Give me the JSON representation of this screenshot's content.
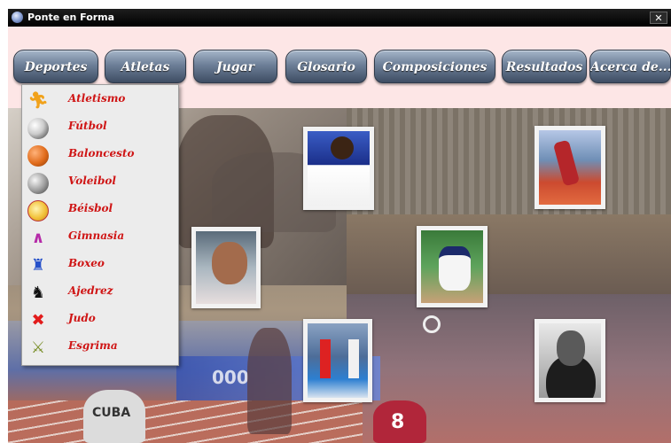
{
  "window": {
    "title": "Ponte en Forma",
    "close_symbol": "✕"
  },
  "menu": [
    {
      "label": "Deportes"
    },
    {
      "label": "Atletas"
    },
    {
      "label": "Jugar"
    },
    {
      "label": "Glosario"
    },
    {
      "label": "Composiciones"
    },
    {
      "label": "Resultados"
    },
    {
      "label": "Acerca de..."
    }
  ],
  "dropdown": {
    "items": [
      {
        "label": "Atletismo",
        "icon": "runner-icon"
      },
      {
        "label": "Fútbol",
        "icon": "soccer-ball-icon"
      },
      {
        "label": "Baloncesto",
        "icon": "basketball-icon"
      },
      {
        "label": "Voleibol",
        "icon": "volleyball-icon"
      },
      {
        "label": "Béisbol",
        "icon": "baseball-icon"
      },
      {
        "label": "Gimnasia",
        "icon": "gymnast-icon"
      },
      {
        "label": "Boxeo",
        "icon": "boxer-icon"
      },
      {
        "label": "Ajedrez",
        "icon": "chess-knight-icon"
      },
      {
        "label": "Judo",
        "icon": "judo-icon"
      },
      {
        "label": "Esgrima",
        "icon": "fencing-swords-icon"
      }
    ],
    "label_color": "#cf1515"
  },
  "collage": {
    "jersey_number": "8",
    "shirt_text": "CUBA",
    "banner_text": "000"
  },
  "colors": {
    "window_bg": "#fde6e6",
    "menu_button": "#6d7f98"
  }
}
